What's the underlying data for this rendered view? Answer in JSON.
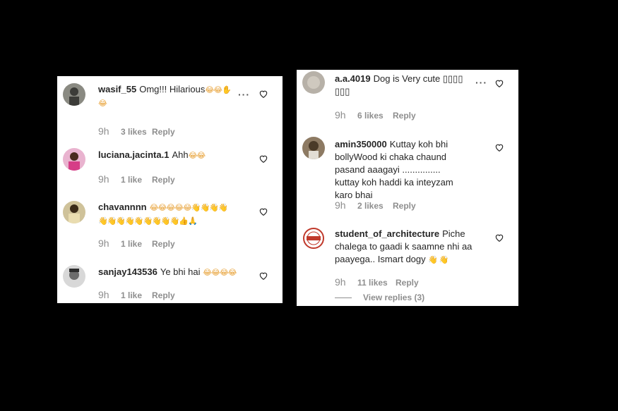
{
  "left_panel": {
    "comments": [
      {
        "username": "wasif_55",
        "text": "Omg!!! Hilarious",
        "emoji": "😂😂✋\n😂",
        "time": "9h",
        "likes": "3 likes",
        "reply": "Reply",
        "avatar_color": "#5b5b52"
      },
      {
        "username": "luciana.jacinta.1",
        "text": "Ahh",
        "emoji": "😂😂",
        "time": "9h",
        "likes": "1 like",
        "reply": "Reply",
        "avatar_color": "#d63d87"
      },
      {
        "username": "chavannnn",
        "text": "",
        "emoji": "😂😂😂😂😂👋👋👋👋\n👋👋👋👋👋👋👋👋👋👍🙏",
        "time": "9h",
        "likes": "1 like",
        "reply": "Reply",
        "avatar_color": "#a89a6a"
      },
      {
        "username": "sanjay143536",
        "text": "Ye bhi hai",
        "emoji": "😂😂😂😂",
        "time": "9h",
        "likes": "1 like",
        "reply": "Reply",
        "avatar_color": "#9a9a9a"
      }
    ]
  },
  "right_panel": {
    "comments": [
      {
        "username": "a.a.4019",
        "text": "Dog is Very cute ▯▯▯▯\n▯▯▯",
        "emoji": "",
        "time": "9h",
        "likes": "6 likes",
        "reply": "Reply",
        "avatar_color": "#b7b1a8"
      },
      {
        "username": "amin350000",
        "text": "Kuttay koh bhi bollyWood ki chaka chaund pasand aaagayi ............... kuttay koh haddi ka inteyzam karo bhai",
        "emoji": "",
        "time": "9h",
        "likes": "2 likes",
        "reply": "Reply",
        "avatar_color": "#6b5a48"
      },
      {
        "username": "student_of_architecture",
        "text": "Piche chalega to gaadi k saamne nhi aa paayega.. Ismart dogy",
        "emoji": "👋 👋",
        "time": "9h",
        "likes": "11 likes",
        "reply": "Reply",
        "avatar_color": "#c0392b"
      }
    ],
    "view_replies": "View replies (3)"
  },
  "icons": {
    "heart": "heart-outline-icon",
    "more": "more-options-icon"
  },
  "colors": {
    "background": "#000000",
    "panel": "#ffffff",
    "text": "#262626",
    "meta": "#8e8e8e"
  }
}
